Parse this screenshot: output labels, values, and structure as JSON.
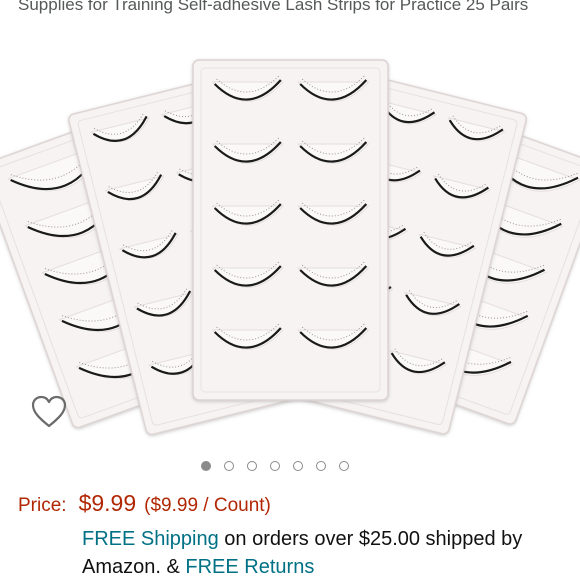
{
  "product": {
    "title": "Supplies for Training Self-adhesive Lash Strips for Practice 25 Pairs"
  },
  "gallery": {
    "image_icon": "product-photo-lash-trays",
    "wishlist_icon": "heart-outline-icon",
    "dot_count": 7,
    "active_dot": 0
  },
  "price": {
    "label": "Price:",
    "value": "$9.99",
    "per_unit": "($9.99 / Count)",
    "color": "#B12704"
  },
  "shipping": {
    "free_shipping_link": "FREE Shipping",
    "text_1": " on orders over $25.00 shipped by Amazon. & ",
    "free_returns_link": "FREE Returns",
    "link_color": "#007185"
  }
}
